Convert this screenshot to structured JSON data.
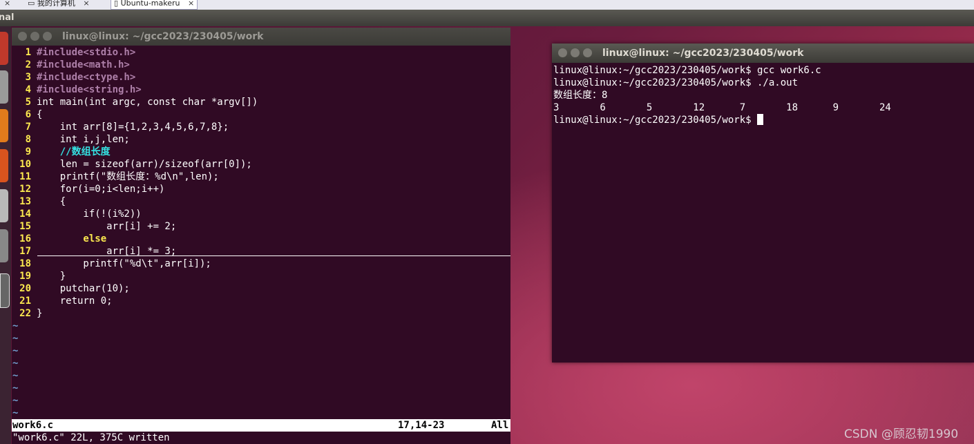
{
  "host_tabs": [
    {
      "label": "我的计算机",
      "close": "×"
    },
    {
      "label": "Ubuntu-makeru",
      "close": "×"
    }
  ],
  "panel_title": "nal",
  "vim_window": {
    "title": "linux@linux: ~/gcc2023/230405/work",
    "lines": [
      {
        "n": "1",
        "text": "#include<stdio.h>"
      },
      {
        "n": "2",
        "text": "#include<math.h>"
      },
      {
        "n": "3",
        "text": "#include<ctype.h>"
      },
      {
        "n": "4",
        "text": "#include<string.h>"
      },
      {
        "n": "5",
        "text": "int main(int argc, const char *argv[])"
      },
      {
        "n": "6",
        "text": "{"
      },
      {
        "n": "7",
        "text": "    int arr[8]={1,2,3,4,5,6,7,8};"
      },
      {
        "n": "8",
        "text": "    int i,j,len;"
      },
      {
        "n": "9",
        "text": "    //数组长度"
      },
      {
        "n": "10",
        "text": "    len = sizeof(arr)/sizeof(arr[0]);"
      },
      {
        "n": "11",
        "text": "    printf(\"数组长度：%d\\n\",len);"
      },
      {
        "n": "12",
        "text": "    for(i=0;i<len;i++)"
      },
      {
        "n": "13",
        "text": "    {"
      },
      {
        "n": "14",
        "text": "        if(!(i%2))"
      },
      {
        "n": "15",
        "text": "            arr[i] += 2;"
      },
      {
        "n": "16",
        "text": "        else"
      },
      {
        "n": "17",
        "text": "            arr[i] *= 3;"
      },
      {
        "n": "18",
        "text": "        printf(\"%d\\t\",arr[i]);"
      },
      {
        "n": "19",
        "text": "    }"
      },
      {
        "n": "20",
        "text": "    putchar(10);"
      },
      {
        "n": "21",
        "text": "    return 0;"
      },
      {
        "n": "22",
        "text": "}"
      }
    ],
    "tilde": "~",
    "statusline": {
      "filename": "work6.c",
      "position": "17,14-23",
      "scroll": "All"
    },
    "message": "\"work6.c\" 22L, 375C written"
  },
  "terminal_window": {
    "title": "linux@linux: ~/gcc2023/230405/work",
    "output": [
      "linux@linux:~/gcc2023/230405/work$ gcc work6.c",
      "linux@linux:~/gcc2023/230405/work$ ./a.out",
      "数组长度：8",
      "3       6       5       12      7       18      9       24",
      "linux@linux:~/gcc2023/230405/work$ "
    ]
  },
  "watermark": "CSDN @顾忍韧1990"
}
